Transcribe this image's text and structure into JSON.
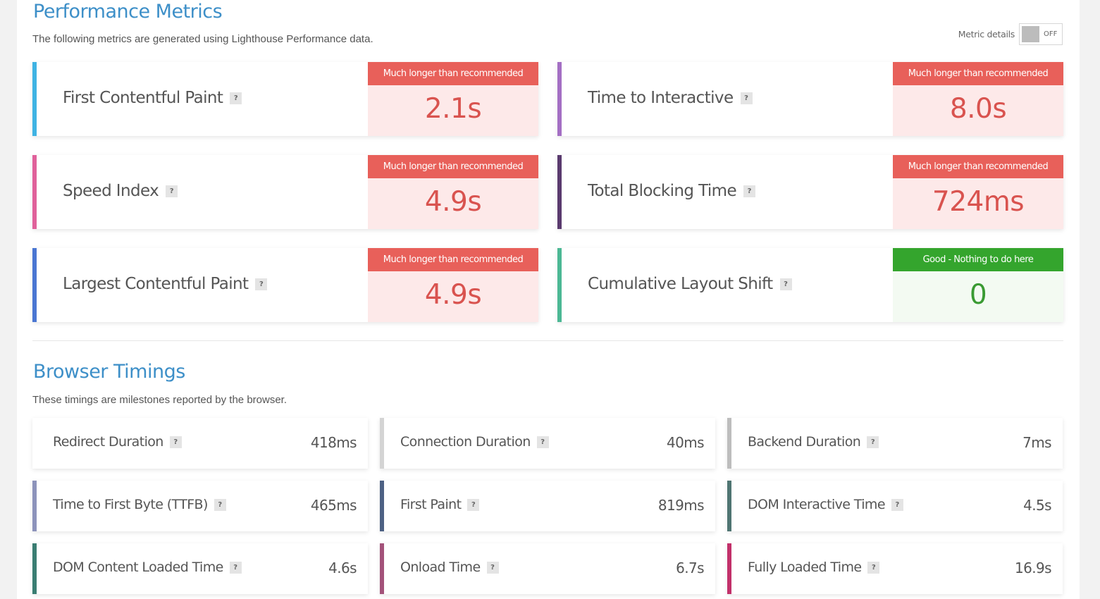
{
  "performance": {
    "title": "Performance Metrics",
    "description": "The following metrics are generated using Lighthouse Performance data.",
    "toggle": {
      "label": "Metric details",
      "state": "OFF"
    },
    "help_glyph": "?",
    "metrics": [
      {
        "name": "First Contentful Paint",
        "status": "Much longer than recommended",
        "rating": "bad",
        "value": "2.1s",
        "accent": "#3fb3e3"
      },
      {
        "name": "Time to Interactive",
        "status": "Much longer than recommended",
        "rating": "bad",
        "value": "8.0s",
        "accent": "#a46fc4"
      },
      {
        "name": "Speed Index",
        "status": "Much longer than recommended",
        "rating": "bad",
        "value": "4.9s",
        "accent": "#e0619b"
      },
      {
        "name": "Total Blocking Time",
        "status": "Much longer than recommended",
        "rating": "bad",
        "value": "724ms",
        "accent": "#5a3a6e"
      },
      {
        "name": "Largest Contentful Paint",
        "status": "Much longer than recommended",
        "rating": "bad",
        "value": "4.9s",
        "accent": "#4a76d2"
      },
      {
        "name": "Cumulative Layout Shift",
        "status": "Good - Nothing to do here",
        "rating": "good",
        "value": "0",
        "accent": "#4cb894"
      }
    ]
  },
  "browser": {
    "title": "Browser Timings",
    "description": "These timings are milestones reported by the browser.",
    "timings": [
      {
        "name": "Redirect Duration",
        "value": "418ms",
        "accent": "#ffffff"
      },
      {
        "name": "Connection Duration",
        "value": "40ms",
        "accent": "#d4d4d4"
      },
      {
        "name": "Backend Duration",
        "value": "7ms",
        "accent": "#bdbdbd"
      },
      {
        "name": "Time to First Byte (TTFB)",
        "value": "465ms",
        "accent": "#8d93bb"
      },
      {
        "name": "First Paint",
        "value": "819ms",
        "accent": "#4d6184"
      },
      {
        "name": "DOM Interactive Time",
        "value": "4.5s",
        "accent": "#4f7572"
      },
      {
        "name": "DOM Content Loaded Time",
        "value": "4.6s",
        "accent": "#3a7d72"
      },
      {
        "name": "Onload Time",
        "value": "6.7s",
        "accent": "#a3527a"
      },
      {
        "name": "Fully Loaded Time",
        "value": "16.9s",
        "accent": "#c2306a"
      }
    ]
  }
}
